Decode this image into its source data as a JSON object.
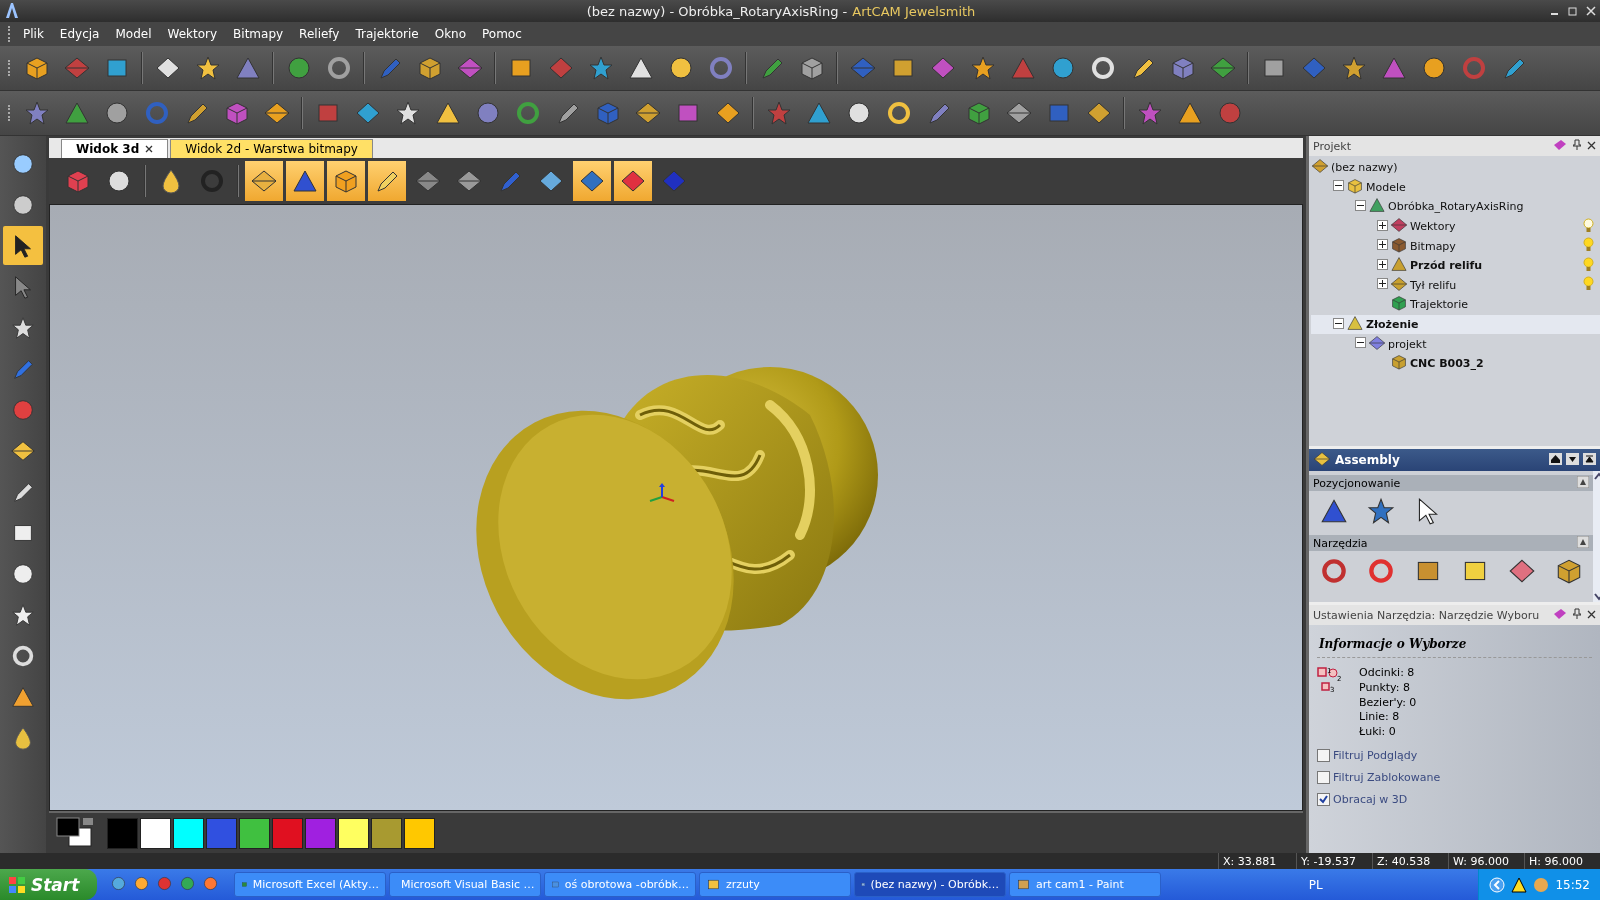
{
  "window": {
    "title": "(bez nazwy) - Obróbka_RotaryAxisRing -",
    "app_name": "ArtCAM Jewelsmith"
  },
  "menu": [
    "Plik",
    "Edycja",
    "Model",
    "Wektory",
    "Bitmapy",
    "Reliefy",
    "Trajektorie",
    "Okno",
    "Pomoc"
  ],
  "tabs": [
    {
      "label": "Widok 3d",
      "selected": true
    },
    {
      "label": "Widok 2d - Warstwa bitmapy",
      "selected": false
    }
  ],
  "palette": [
    {
      "color": "#000000"
    },
    {
      "color": "#ffffff"
    },
    {
      "color": "#00ffff"
    },
    {
      "color": "#3050e0"
    },
    {
      "color": "#40c040"
    },
    {
      "color": "#e01020"
    },
    {
      "color": "#a020e0"
    },
    {
      "color": "#ffff60"
    },
    {
      "color": "#a89a30"
    },
    {
      "color": "#ffc800"
    }
  ],
  "project_panel": {
    "title": "Projekt",
    "tree": [
      {
        "label": "(bez nazwy)",
        "selected": false,
        "active": false,
        "children": [
          {
            "label": "Modele",
            "expanded": true,
            "selected": false,
            "active": false,
            "children": [
              {
                "label": "Obróbka_RotaryAxisRing",
                "expanded": true,
                "selected": false,
                "active": false,
                "children": [
                  {
                    "label": "Wektory",
                    "expanded": false,
                    "selected": false,
                    "active": false,
                    "visible": false
                  },
                  {
                    "label": "Bitmapy",
                    "expanded": false,
                    "selected": false,
                    "active": false,
                    "visible": true
                  },
                  {
                    "label": "Przód relifu",
                    "expanded": false,
                    "selected": false,
                    "active": true,
                    "visible": true
                  },
                  {
                    "label": "Tył relifu",
                    "expanded": false,
                    "selected": false,
                    "active": false,
                    "visible": true
                  },
                  {
                    "label": "Trajektorie",
                    "selected": false,
                    "active": false
                  }
                ]
              }
            ]
          },
          {
            "label": "Złożenie",
            "expanded": true,
            "selected": true,
            "active": true,
            "children": [
              {
                "label": "projekt",
                "expanded": true,
                "selected": false,
                "active": false,
                "children": [
                  {
                    "label": "CNC B003_2",
                    "selected": false,
                    "active": true
                  }
                ]
              }
            ]
          }
        ]
      }
    ]
  },
  "assembly_panel": {
    "title": "Assembly",
    "sections": [
      "Pozycjonowanie",
      "Narzędzia"
    ]
  },
  "tool_settings": {
    "title": "Ustawienia Narzędzia: Narzędzie Wyboru",
    "heading": "Informacje o Wyborze",
    "icon_labels": [
      "1",
      "2",
      "3"
    ],
    "stats": [
      "Odcinki: 8",
      "Punkty: 8",
      "Bezier'y: 0",
      "Linie: 8",
      "Łuki: 0"
    ],
    "options": [
      {
        "label": "Filtruj Podglądy",
        "checked": false
      },
      {
        "label": "Filtruj Zablokowane",
        "checked": false
      },
      {
        "label": "Obracaj w 3D",
        "checked": true
      }
    ]
  },
  "status_bar": [
    "X: 33.881",
    "Y: -19.537",
    "Z: 40.538",
    "W: 96.000",
    "H: 96.000"
  ],
  "taskbar": {
    "start": "Start",
    "tasks": [
      {
        "label": "Microsoft Excel (Akty…",
        "selected": false
      },
      {
        "label": "Microsoft Visual Basic …",
        "selected": false
      },
      {
        "label": "oś obrotowa -obróbk…",
        "selected": false
      },
      {
        "label": "zrzuty",
        "selected": false
      },
      {
        "label": "(bez nazwy) - Obróbk…",
        "selected": true
      },
      {
        "label": "art cam1 - Paint",
        "selected": false
      }
    ],
    "language": "PL",
    "clock": "15:52"
  }
}
